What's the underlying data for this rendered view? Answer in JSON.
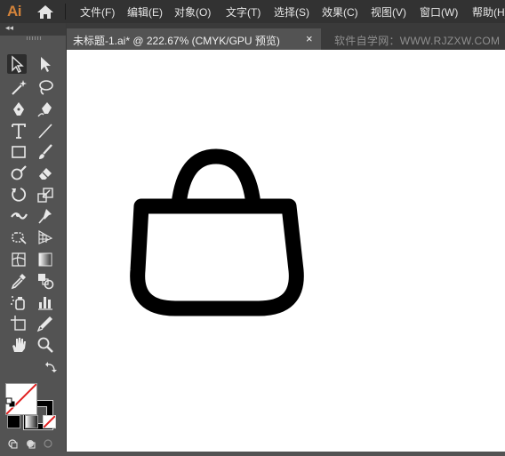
{
  "app": {
    "logo": "Ai"
  },
  "menu": [
    "文件(F)",
    "编辑(E)",
    "对象(O)",
    "文字(T)",
    "选择(S)",
    "效果(C)",
    "视图(V)",
    "窗口(W)",
    "帮助(H)"
  ],
  "document_tab": {
    "title": "未标题-1.ai* @ 222.67% (CMYK/GPU 预览)",
    "close": "×"
  },
  "watermark": "软件自学网：WWW.RJZXW.COM",
  "toolbar": {
    "collapse": "◂◂",
    "tools": [
      "selection-tool",
      "direct-selection-tool",
      "magic-wand-tool",
      "lasso-tool",
      "pen-tool",
      "curvature-tool",
      "type-tool",
      "line-segment-tool",
      "rectangle-tool",
      "paintbrush-tool",
      "shaper-tool",
      "eraser-tool",
      "rotate-tool",
      "scale-tool",
      "width-tool",
      "puppet-warp-tool",
      "free-transform-tool",
      "perspective-grid-tool",
      "mesh-tool",
      "gradient-tool",
      "eyedropper-tool",
      "blend-tool",
      "symbol-sprayer-tool",
      "column-graph-tool",
      "artboard-tool",
      "slice-tool",
      "hand-tool",
      "zoom-tool"
    ],
    "selected_tool": "selection-tool"
  },
  "colors": {
    "fill": "none",
    "stroke": "#000000",
    "accent": "#d3833a"
  },
  "artwork": {
    "shape": "shopping-bag-icon",
    "stroke": "#000000"
  }
}
